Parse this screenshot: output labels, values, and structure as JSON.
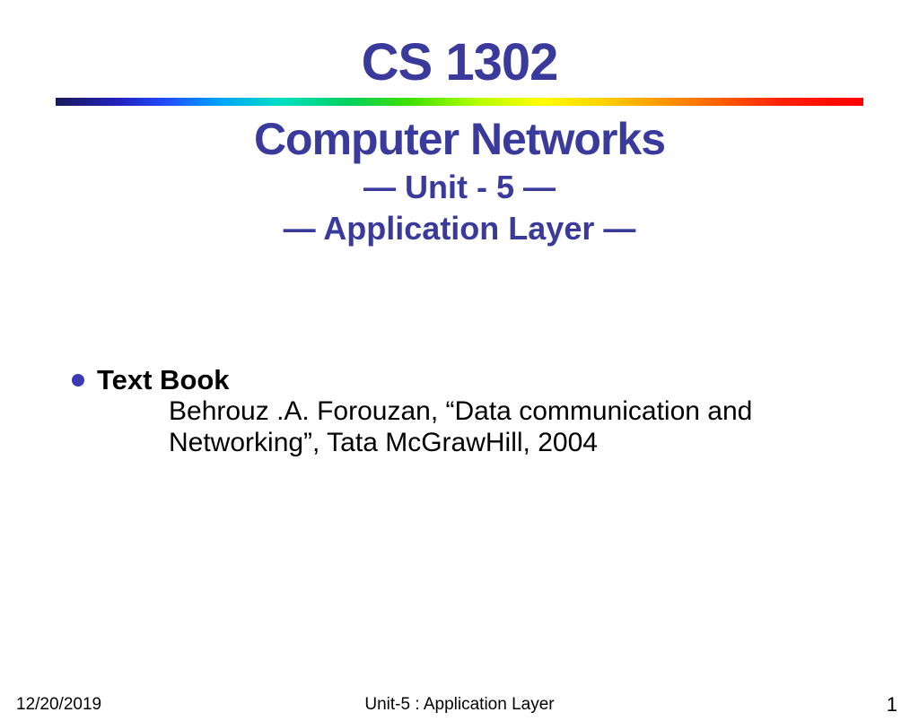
{
  "title": {
    "line1": "CS 1302",
    "line2": "Computer Networks",
    "line3": "— Unit - 5 —",
    "line4": "— Application Layer —"
  },
  "content": {
    "bullet_title": "Text Book",
    "bullet_body": "Behrouz .A. Forouzan, “Data communication and Networking”, Tata McGrawHill, 2004"
  },
  "footer": {
    "date": "12/20/2019",
    "center": "Unit-5 : Application Layer",
    "page": "1"
  }
}
